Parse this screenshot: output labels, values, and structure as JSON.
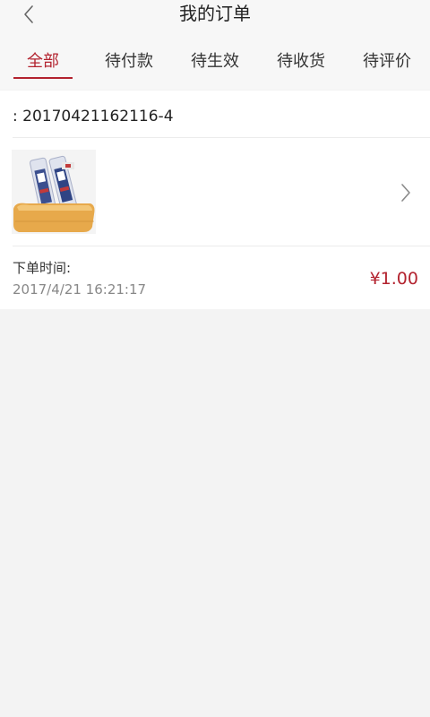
{
  "header": {
    "title": "我的订单",
    "back_icon": "chevron-left-icon"
  },
  "tabs": [
    {
      "label": "全部",
      "active": true
    },
    {
      "label": "待付款",
      "active": false
    },
    {
      "label": "待生效",
      "active": false
    },
    {
      "label": "待收货",
      "active": false
    },
    {
      "label": "待评价",
      "active": false
    }
  ],
  "colors": {
    "accent": "#b3232f",
    "background": "#f3f3f3"
  },
  "order": {
    "order_number": ": 20170421162116-4",
    "product_image": "bread-product-image",
    "detail_icon": "chevron-right-icon",
    "time_label": "下单时间:",
    "time_value": "2017/4/21 16:21:17",
    "price": "¥1.00"
  }
}
